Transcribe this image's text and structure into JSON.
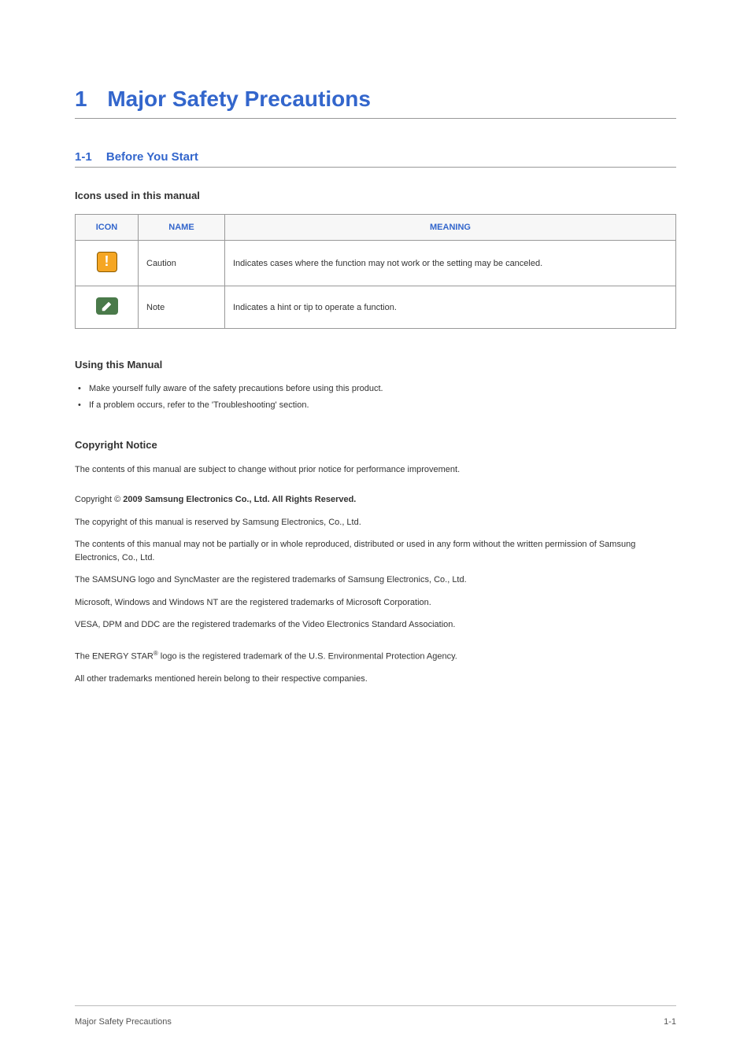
{
  "chapter": {
    "number": "1",
    "title": "Major Safety Precautions"
  },
  "section": {
    "number": "1-1",
    "title": "Before You Start"
  },
  "subsections": {
    "icons_heading": "Icons used in this manual",
    "using_heading": "Using this Manual",
    "copyright_heading": "Copyright Notice"
  },
  "table": {
    "headers": {
      "icon": "ICON",
      "name": "NAME",
      "meaning": "MEANING"
    },
    "rows": [
      {
        "name": "Caution",
        "meaning": "Indicates cases where the function may not work or the setting may be canceled."
      },
      {
        "name": "Note",
        "meaning": "Indicates a hint or tip to operate a function."
      }
    ]
  },
  "using_list": [
    "Make yourself fully aware of the safety precautions before using this product.",
    "If a problem occurs, refer to the 'Troubleshooting' section."
  ],
  "copyright": {
    "intro": "The contents of this manual are subject to change without prior notice for performance improvement.",
    "line_prefix": "Copyright © ",
    "line_bold": "2009 Samsung Electronics Co., Ltd. All Rights Reserved.",
    "reserved": "The copyright of this manual is reserved by Samsung Electronics, Co., Ltd.",
    "reproduce": "The contents of this manual may not be partially or in whole reproduced, distributed or used in any form without the written permission of Samsung Electronics, Co., Ltd.",
    "samsung_tm": "The SAMSUNG logo and SyncMaster are the registered trademarks of Samsung Electronics, Co., Ltd.",
    "ms_tm": "Microsoft, Windows and Windows NT are the registered trademarks of Microsoft Corporation.",
    "vesa_tm": "VESA, DPM and DDC are the registered trademarks of the Video Electronics Standard Association.",
    "energy_prefix": "The ENERGY STAR",
    "energy_sup": "®",
    "energy_suffix": " logo is the registered trademark of the U.S. Environmental Protection Agency.",
    "other_tm": "All other trademarks mentioned herein belong to their respective companies."
  },
  "footer": {
    "left": "Major Safety Precautions",
    "right": "1-1"
  }
}
